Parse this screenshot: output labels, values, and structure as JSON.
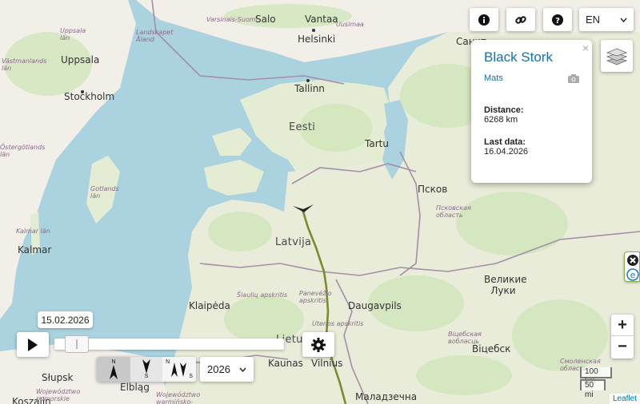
{
  "toolbar": {
    "info_icon": "info-icon",
    "link_icon": "link-icon",
    "help_icon": "question-icon",
    "language": "EN",
    "layers_icon": "layers-icon"
  },
  "popup": {
    "title": "Black Stork",
    "user": "Mats",
    "distance_label": "Distance:",
    "distance_value": "6268 km",
    "lastdata_label": "Last data:",
    "lastdata_value": "16.04.2026",
    "close": "×"
  },
  "timeline": {
    "date": "15.02.2026",
    "position_fraction": 0.05,
    "year": "2026",
    "dir_n": "N",
    "dir_s": "S"
  },
  "zoom": {
    "in": "+",
    "out": "−"
  },
  "scale": {
    "km": "100 km",
    "mi": "50 mi"
  },
  "attribution": "Leaflet",
  "colors": {
    "track": "#7d8a2e",
    "water": "#aad3df",
    "land": "#f2efe9",
    "forest": "#cfe6b8",
    "popup_title": "#1a6fa3"
  },
  "places": {
    "cities": {
      "salo": "Salo",
      "vantaa": "Vantaa",
      "helsinki": "Helsinki",
      "tallinn": "Tallinn",
      "tartu": "Tartu",
      "stockholm": "Stockholm",
      "uppsala": "Uppsala",
      "pskov": "Псков",
      "daugavpils": "Daugavpils",
      "klaipeda": "Klaipėda",
      "kaunas": "Kaunas",
      "vilnius": "Vilnius",
      "elblag": "Elbląg",
      "slupsk": "Słupsk",
      "kalmar": "Kalmar",
      "vitebsk": "Віцебск",
      "molodechno": "Маладзечна",
      "kozalin": "Koszalin",
      "sankt": "Санкт",
      "velikie": "Великие Луки"
    },
    "countries": {
      "eesti": "Eesti",
      "latvija": "Latvija",
      "lietuva": "Lietuva"
    },
    "regions": {
      "varsinais": "Varsinais-Suomi",
      "uusimaa": "Uusimaa",
      "landskapet": "Landskapet Åland",
      "uppsala_lan": "Uppsala län",
      "vastmanland": "Västmanlands län",
      "ostergotland": "Östergötlands län",
      "gotlands": "Gotlands län",
      "kalmar_lan": "Kalmar län",
      "pskov_obl": "Псковская область",
      "siauliu": "Šiaulių apskritis",
      "panevezio": "Panevėžio apskritis",
      "utenos": "Utenos apskritis",
      "vitebsk_obl": "Віцебская вобласць",
      "smolensk": "Смоленская область",
      "pomorskie": "Województwo pomorskie",
      "warminsko": "Województwo warmińsko-mazurskie"
    }
  }
}
